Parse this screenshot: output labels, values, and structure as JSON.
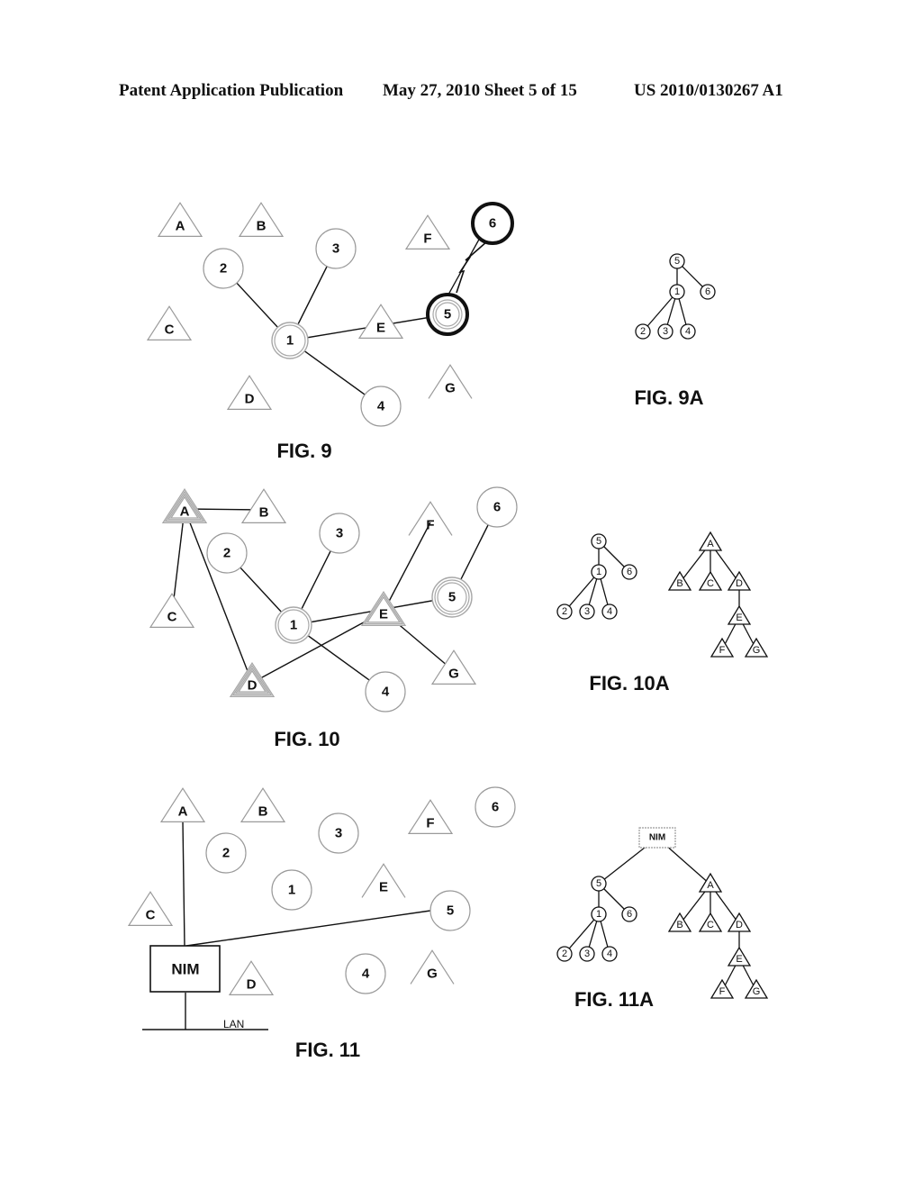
{
  "header": {
    "left": "Patent Application Publication",
    "middle": "May 27, 2010  Sheet 5 of 15",
    "right": "US 2010/0130267 A1"
  },
  "colors": {
    "ink": "#111111",
    "faint": "#9a9a9a",
    "double": "#a8a8a8"
  },
  "figures": [
    {
      "id": "fig9",
      "caption": "FIG. 9",
      "nodes": [
        {
          "id": "A",
          "shape": "triangle",
          "style": "faint"
        },
        {
          "id": "B",
          "shape": "triangle",
          "style": "faint"
        },
        {
          "id": "C",
          "shape": "triangle",
          "style": "faint"
        },
        {
          "id": "D",
          "shape": "triangle",
          "style": "faint"
        },
        {
          "id": "E",
          "shape": "triangle",
          "style": "faint"
        },
        {
          "id": "F",
          "shape": "triangle",
          "style": "faint"
        },
        {
          "id": "G",
          "shape": "triangle-open",
          "style": "faint"
        },
        {
          "id": "1",
          "shape": "circle",
          "style": "double"
        },
        {
          "id": "2",
          "shape": "circle",
          "style": "faint"
        },
        {
          "id": "3",
          "shape": "circle",
          "style": "faint"
        },
        {
          "id": "4",
          "shape": "circle",
          "style": "faint"
        },
        {
          "id": "5",
          "shape": "circle",
          "style": "bold-double"
        },
        {
          "id": "6",
          "shape": "circle",
          "style": "bold"
        }
      ],
      "edges": [
        {
          "from": "1",
          "to": "2",
          "type": "line"
        },
        {
          "from": "1",
          "to": "3",
          "type": "line"
        },
        {
          "from": "1",
          "to": "4",
          "type": "line"
        },
        {
          "from": "1",
          "to": "5",
          "type": "line"
        },
        {
          "from": "5",
          "to": "6",
          "type": "wireless-link"
        }
      ]
    },
    {
      "id": "fig9a",
      "caption": "FIG. 9A",
      "tree": {
        "label": "5",
        "shape": "circle",
        "children": [
          {
            "label": "1",
            "shape": "circle",
            "children": [
              {
                "label": "2",
                "shape": "circle"
              },
              {
                "label": "3",
                "shape": "circle"
              },
              {
                "label": "4",
                "shape": "circle"
              }
            ]
          },
          {
            "label": "6",
            "shape": "circle"
          }
        ]
      }
    },
    {
      "id": "fig10",
      "caption": "FIG. 10",
      "nodes": [
        {
          "id": "A",
          "shape": "triangle",
          "style": "triple"
        },
        {
          "id": "B",
          "shape": "triangle",
          "style": "faint"
        },
        {
          "id": "C",
          "shape": "triangle",
          "style": "faint"
        },
        {
          "id": "D",
          "shape": "triangle",
          "style": "triple"
        },
        {
          "id": "E",
          "shape": "triangle",
          "style": "double"
        },
        {
          "id": "F",
          "shape": "triangle-open",
          "style": "faint"
        },
        {
          "id": "G",
          "shape": "triangle",
          "style": "faint"
        },
        {
          "id": "1",
          "shape": "circle",
          "style": "double"
        },
        {
          "id": "2",
          "shape": "circle",
          "style": "faint"
        },
        {
          "id": "3",
          "shape": "circle",
          "style": "faint"
        },
        {
          "id": "4",
          "shape": "circle",
          "style": "faint"
        },
        {
          "id": "5",
          "shape": "circle",
          "style": "triple"
        },
        {
          "id": "6",
          "shape": "circle",
          "style": "faint"
        }
      ],
      "edges": [
        {
          "from": "A",
          "to": "B",
          "type": "line"
        },
        {
          "from": "A",
          "to": "C",
          "type": "line"
        },
        {
          "from": "A",
          "to": "D",
          "type": "line"
        },
        {
          "from": "D",
          "to": "E",
          "type": "line"
        },
        {
          "from": "E",
          "to": "F",
          "type": "line"
        },
        {
          "from": "E",
          "to": "G",
          "type": "line"
        },
        {
          "from": "1",
          "to": "2",
          "type": "line"
        },
        {
          "from": "1",
          "to": "3",
          "type": "line"
        },
        {
          "from": "1",
          "to": "4",
          "type": "line"
        },
        {
          "from": "1",
          "to": "5",
          "type": "line"
        },
        {
          "from": "5",
          "to": "6",
          "type": "line"
        }
      ]
    },
    {
      "id": "fig10a",
      "caption": "FIG. 10A",
      "trees": [
        {
          "label": "5",
          "shape": "circle",
          "children": [
            {
              "label": "1",
              "shape": "circle",
              "children": [
                {
                  "label": "2",
                  "shape": "circle"
                },
                {
                  "label": "3",
                  "shape": "circle"
                },
                {
                  "label": "4",
                  "shape": "circle"
                }
              ]
            },
            {
              "label": "6",
              "shape": "circle"
            }
          ]
        },
        {
          "label": "A",
          "shape": "triangle",
          "children": [
            {
              "label": "B",
              "shape": "triangle"
            },
            {
              "label": "C",
              "shape": "triangle"
            },
            {
              "label": "D",
              "shape": "triangle",
              "children": [
                {
                  "label": "E",
                  "shape": "triangle",
                  "children": [
                    {
                      "label": "F",
                      "shape": "triangle"
                    },
                    {
                      "label": "G",
                      "shape": "triangle"
                    }
                  ]
                }
              ]
            }
          ]
        }
      ]
    },
    {
      "id": "fig11",
      "caption": "FIG. 11",
      "nim_label": "NIM",
      "lan_label": "LAN",
      "nodes": [
        {
          "id": "A",
          "shape": "triangle",
          "style": "faint"
        },
        {
          "id": "B",
          "shape": "triangle",
          "style": "faint"
        },
        {
          "id": "C",
          "shape": "triangle",
          "style": "faint"
        },
        {
          "id": "D",
          "shape": "triangle",
          "style": "faint"
        },
        {
          "id": "E",
          "shape": "triangle-open",
          "style": "faint"
        },
        {
          "id": "F",
          "shape": "triangle",
          "style": "faint"
        },
        {
          "id": "G",
          "shape": "triangle-open",
          "style": "faint"
        },
        {
          "id": "1",
          "shape": "circle",
          "style": "faint"
        },
        {
          "id": "2",
          "shape": "circle",
          "style": "faint"
        },
        {
          "id": "3",
          "shape": "circle",
          "style": "faint"
        },
        {
          "id": "4",
          "shape": "circle",
          "style": "faint"
        },
        {
          "id": "5",
          "shape": "circle",
          "style": "faint"
        },
        {
          "id": "6",
          "shape": "circle",
          "style": "faint"
        }
      ],
      "edges": [
        {
          "from": "NIM",
          "to": "A",
          "type": "line"
        },
        {
          "from": "NIM",
          "to": "5",
          "type": "line"
        },
        {
          "from": "NIM",
          "to": "LAN",
          "type": "line"
        }
      ]
    },
    {
      "id": "fig11a",
      "caption": "FIG. 11A",
      "tree": {
        "label": "NIM",
        "shape": "box",
        "children": [
          {
            "label": "5",
            "shape": "circle",
            "children": [
              {
                "label": "1",
                "shape": "circle",
                "children": [
                  {
                    "label": "2",
                    "shape": "circle"
                  },
                  {
                    "label": "3",
                    "shape": "circle"
                  },
                  {
                    "label": "4",
                    "shape": "circle"
                  }
                ]
              },
              {
                "label": "6",
                "shape": "circle"
              }
            ]
          },
          {
            "label": "A",
            "shape": "triangle",
            "children": [
              {
                "label": "B",
                "shape": "triangle"
              },
              {
                "label": "C",
                "shape": "triangle"
              },
              {
                "label": "D",
                "shape": "triangle",
                "children": [
                  {
                    "label": "E",
                    "shape": "triangle",
                    "children": [
                      {
                        "label": "F",
                        "shape": "triangle"
                      },
                      {
                        "label": "G",
                        "shape": "triangle"
                      }
                    ]
                  }
                ]
              }
            ]
          }
        ]
      }
    }
  ]
}
